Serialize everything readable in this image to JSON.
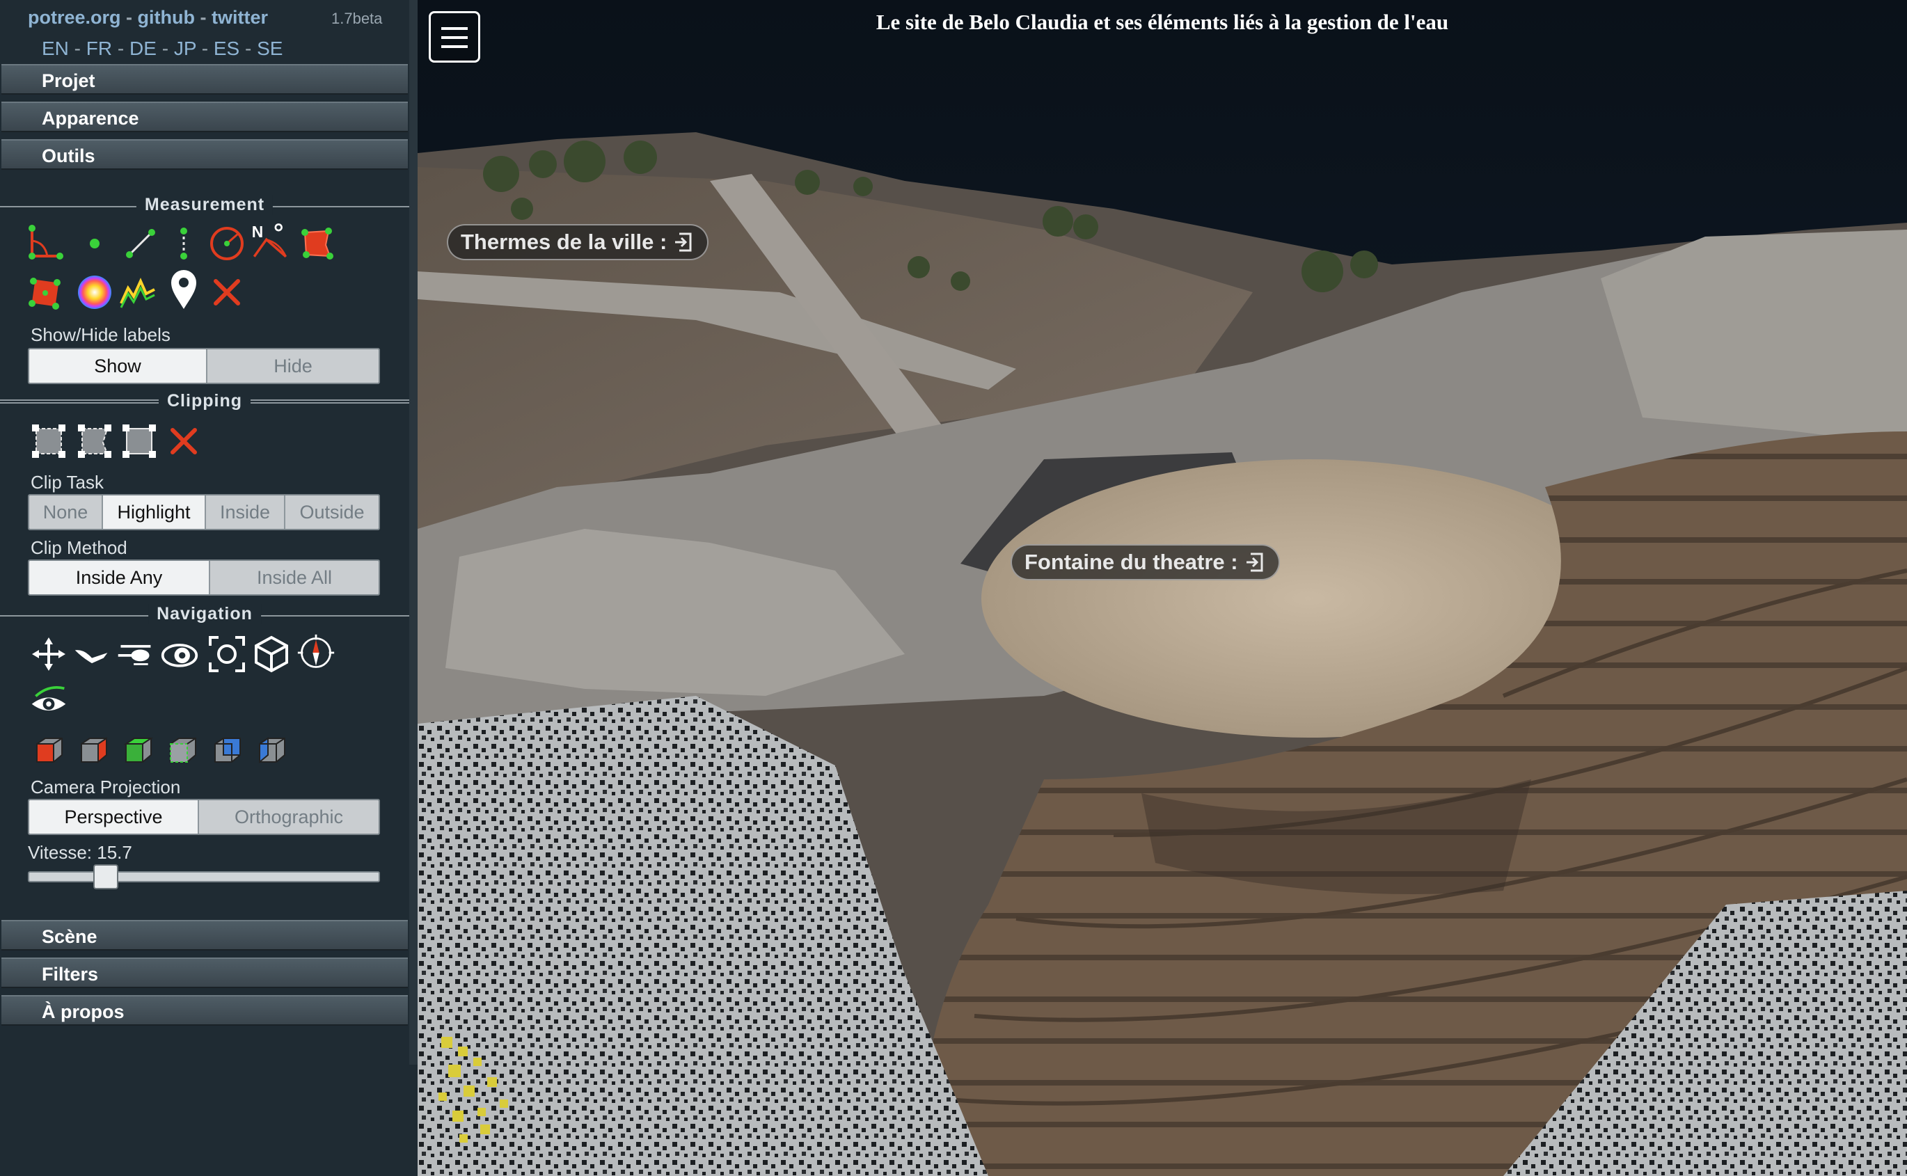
{
  "header": {
    "links": [
      "potree.org",
      "github",
      "twitter"
    ],
    "version": "1.7beta",
    "languages": [
      "EN",
      "FR",
      "DE",
      "JP",
      "ES",
      "SE"
    ]
  },
  "accordion": {
    "projet": "Projet",
    "apparence": "Apparence",
    "outils": "Outils",
    "scene": "Scène",
    "filters": "Filters",
    "apropos": "À propos"
  },
  "measurement": {
    "title": "Measurement",
    "tools": [
      "angle-measure-icon",
      "point-measure-icon",
      "distance-measure-icon",
      "height-measure-icon",
      "circle-measure-icon",
      "azimuth-measure-icon",
      "area-measure-icon",
      "volume-measure-icon",
      "sphere-volume-icon",
      "height-profile-icon",
      "annotation-icon",
      "remove-measurements-icon"
    ],
    "show_hide_label": "Show/Hide labels",
    "show": "Show",
    "hide": "Hide"
  },
  "clipping": {
    "title": "Clipping",
    "tools": [
      "clip-volume-icon",
      "clip-polygon-icon",
      "clip-screen-box-icon",
      "remove-clipping-icon"
    ],
    "clip_task_label": "Clip Task",
    "clip_task_options": [
      "None",
      "Highlight",
      "Inside",
      "Outside"
    ],
    "clip_task_selected": "Highlight",
    "clip_method_label": "Clip Method",
    "clip_method_options": [
      "Inside Any",
      "Inside All"
    ],
    "clip_method_selected": "Inside Any"
  },
  "navigation": {
    "title": "Navigation",
    "controls": [
      "earth-controls-icon",
      "fly-controls-icon",
      "helicopter-controls-icon",
      "orbit-controls-icon",
      "focus-icon",
      "navigation-cube-icon",
      "compass-icon",
      "show-camera-icon"
    ],
    "views": [
      "left-view-icon",
      "front-view-icon",
      "top-view-icon",
      "bottom-view-icon",
      "back-view-icon",
      "right-view-icon"
    ],
    "camera_projection_label": "Camera Projection",
    "perspective": "Perspective",
    "orthographic": "Orthographic",
    "speed_label": "Vitesse: 15.7",
    "speed_fraction": 0.2
  },
  "viewer": {
    "title": "Le site de Belo Claudia et ses éléments liés à la gestion de l'eau",
    "annotations": [
      {
        "label": "Thermes de la ville :"
      },
      {
        "label": "Fontaine du theatre :"
      }
    ]
  },
  "colors": {
    "sidebar_bg": "#1f2b33",
    "link": "#8fb4d3",
    "measure_red": "#e03c1f"
  }
}
